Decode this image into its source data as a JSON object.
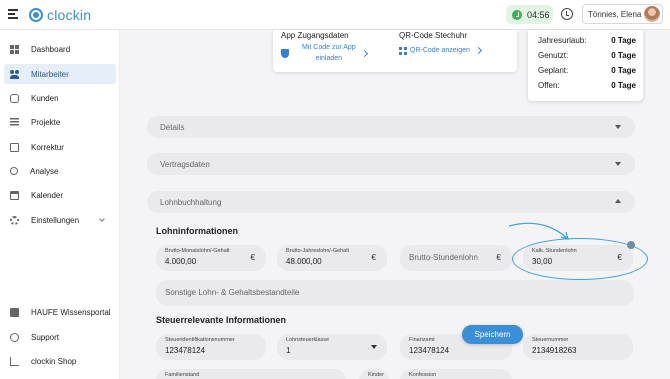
{
  "app": {
    "name": "clockin"
  },
  "topbar": {
    "timer": "04:56",
    "user_name": "Tönnies, Elena"
  },
  "sidebar": {
    "items": [
      {
        "label": "Dashboard",
        "icon": "dashboard-icon"
      },
      {
        "label": "Mitarbeiter",
        "icon": "people-icon",
        "active": true
      },
      {
        "label": "Kunden",
        "icon": "handshake-icon"
      },
      {
        "label": "Projekte",
        "icon": "projects-icon"
      },
      {
        "label": "Korrektur",
        "icon": "edit-icon"
      },
      {
        "label": "Analyse",
        "icon": "analysis-icon"
      },
      {
        "label": "Kalender",
        "icon": "calendar-icon"
      },
      {
        "label": "Einstellungen",
        "icon": "gear-icon"
      }
    ],
    "bottom_items": [
      {
        "label": "HAUFE Wissensportal",
        "icon": "book-icon"
      },
      {
        "label": "Support",
        "icon": "help-icon"
      },
      {
        "label": "clockin Shop",
        "icon": "cart-icon"
      }
    ]
  },
  "app_card": {
    "app_title": "App Zugangsdaten",
    "app_link_line1": "Mit Code zur App",
    "app_link_line2": "einladen",
    "qr_title": "QR-Code Stechuhr",
    "qr_link": "QR-Code anzeigen"
  },
  "vacation": {
    "rows": [
      {
        "label": "Jahresurlaub:",
        "value": "0 Tage"
      },
      {
        "label": "Genutzt:",
        "value": "0 Tage"
      },
      {
        "label": "Geplant:",
        "value": "0 Tage"
      },
      {
        "label": "Offen:",
        "value": "0 Tage"
      }
    ]
  },
  "accordions": {
    "details": "Details",
    "vertrag": "Vertragsdaten",
    "lohn": "Lohnbuchhaltung"
  },
  "lohn": {
    "heading": "Lohninformationen",
    "monthly": {
      "label": "Brutto-Monatslohn/-Gehalt",
      "value": "4.000,00",
      "unit": "€"
    },
    "yearly": {
      "label": "Brutto-Jahreslohn/-Gehalt",
      "value": "48.000,00",
      "unit": "€"
    },
    "hourly": {
      "placeholder": "Brutto-Stundenlohn",
      "unit": "€"
    },
    "calc": {
      "label": "Kalk. Stundenlohn",
      "value": "30,00",
      "unit": "€"
    },
    "other": {
      "placeholder": "Sonstige Lohn- & Gehaltsbestandteile"
    }
  },
  "steuer": {
    "heading": "Steuerrelevante Informationen",
    "id": {
      "label": "Steueridentifikationsnummer",
      "value": "123478124"
    },
    "klasse": {
      "label": "Lohnsteuerklasse",
      "value": "1"
    },
    "amt": {
      "label": "Finanzamt",
      "value": "123478124"
    },
    "nummer": {
      "label": "Steuernummer",
      "value": "2134918263"
    },
    "familienstand": {
      "label": "Familienstand"
    },
    "kinder": {
      "label": "Kinder"
    },
    "konfession": {
      "label": "Konfession"
    }
  },
  "actions": {
    "save": "Speichern"
  },
  "colors": {
    "brand": "#3a8fd6",
    "active_nav_bg": "#e6eef9",
    "timer_bg": "#e3f4e4",
    "field_bg": "#e9e9ee"
  }
}
